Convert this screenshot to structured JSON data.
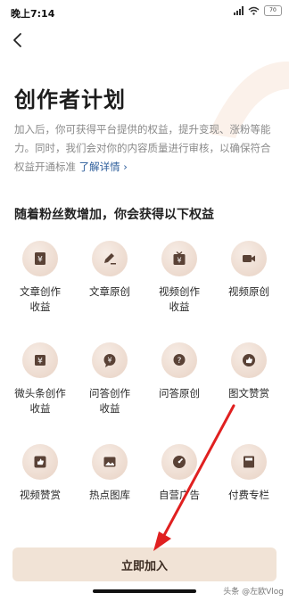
{
  "status_bar": {
    "time": "晚上7:14",
    "battery": "70"
  },
  "page": {
    "title": "创作者计划",
    "desc_text": "加入后，你可获得平台提供的权益，提升变现、涨粉等能力。同时，我们会对你的内容质量进行审核，以确保符合权益开通标准",
    "desc_link": "了解详情 ›",
    "section_title": "随着粉丝数增加，你会获得以下权益"
  },
  "benefits": [
    {
      "label": "文章创作\n收益",
      "icon": "yen-document-icon"
    },
    {
      "label": "文章原创",
      "icon": "pen-icon"
    },
    {
      "label": "视频创作\n收益",
      "icon": "tv-yen-icon"
    },
    {
      "label": "视频原创",
      "icon": "video-camera-icon"
    },
    {
      "label": "微头条创作\n收益",
      "icon": "yen-card-icon"
    },
    {
      "label": "问答创作\n收益",
      "icon": "yen-bubble-icon"
    },
    {
      "label": "问答原创",
      "icon": "question-bubble-icon"
    },
    {
      "label": "图文赞赏",
      "icon": "thumbs-up-icon"
    },
    {
      "label": "视频赞赏",
      "icon": "thumbs-up-card-icon"
    },
    {
      "label": "热点图库",
      "icon": "image-icon"
    },
    {
      "label": "自营广告",
      "icon": "gauge-icon"
    },
    {
      "label": "付费专栏",
      "icon": "book-icon"
    }
  ],
  "join_button": "立即加入",
  "watermark": "头条 @左欧Vlog",
  "colors": {
    "accent_link": "#2b5c9a",
    "button_bg": "#f1e3d6",
    "icon_brown": "#5a4236",
    "arrow_red": "#e02020"
  }
}
